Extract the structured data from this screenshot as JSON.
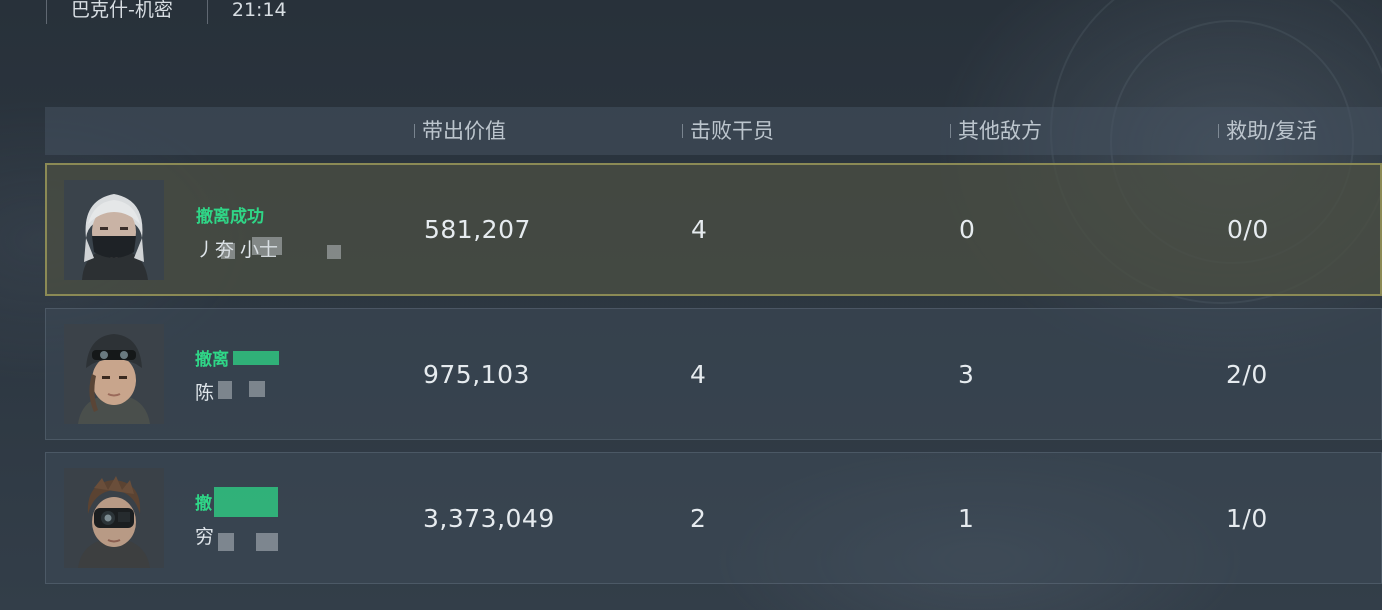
{
  "top_bar": {
    "map": "巴克什-机密",
    "time": "21:14"
  },
  "columns": [
    "带出价值",
    "击败干员",
    "其他敌方",
    "救助/复活"
  ],
  "players": [
    {
      "status": "撤离成功",
      "name": "丿夯 小士",
      "value": "581,207",
      "kills": "4",
      "others": "0",
      "assist_revive": "0/0",
      "highlighted": true,
      "portrait": "white-haired-operator-with-mask"
    },
    {
      "status": "撤离",
      "name": "陈",
      "value": "975,103",
      "kills": "4",
      "others": "3",
      "assist_revive": "2/0",
      "highlighted": false,
      "portrait": "operator-with-goggles-helmet"
    },
    {
      "status": "撤",
      "name": "穷",
      "value": "3,373,049",
      "kills": "2",
      "others": "1",
      "assist_revive": "1/0",
      "highlighted": false,
      "portrait": "operator-with-night-vision"
    }
  ],
  "colors": {
    "success_green": "#2fd687",
    "highlight_border": "#8b8a55"
  }
}
